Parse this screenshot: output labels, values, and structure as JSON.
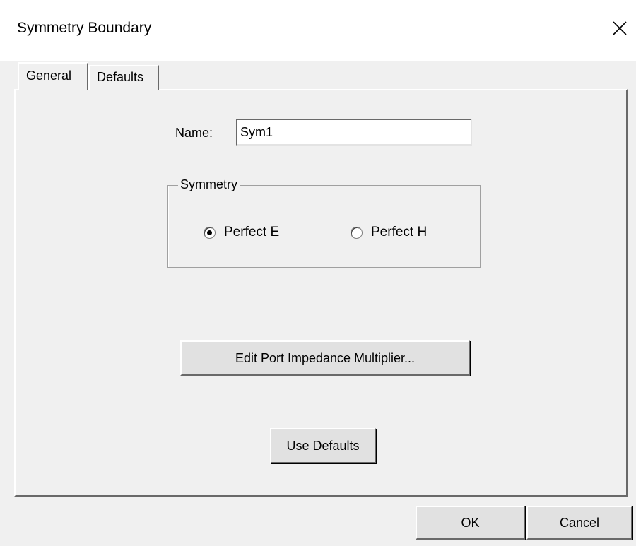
{
  "window": {
    "title": "Symmetry Boundary"
  },
  "tabs": [
    {
      "label": "General",
      "selected": true
    },
    {
      "label": "Defaults",
      "selected": false
    }
  ],
  "general": {
    "name_label": "Name:",
    "name_value": "Sym1",
    "symmetry_group_label": "Symmetry",
    "options": [
      {
        "label": "Perfect E",
        "checked": true
      },
      {
        "label": "Perfect H",
        "checked": false
      }
    ],
    "edit_port_button": "Edit Port Impedance Multiplier...",
    "use_defaults_button": "Use Defaults"
  },
  "footer": {
    "ok_label": "OK",
    "cancel_label": "Cancel"
  },
  "icons": {
    "close": "close-icon"
  }
}
